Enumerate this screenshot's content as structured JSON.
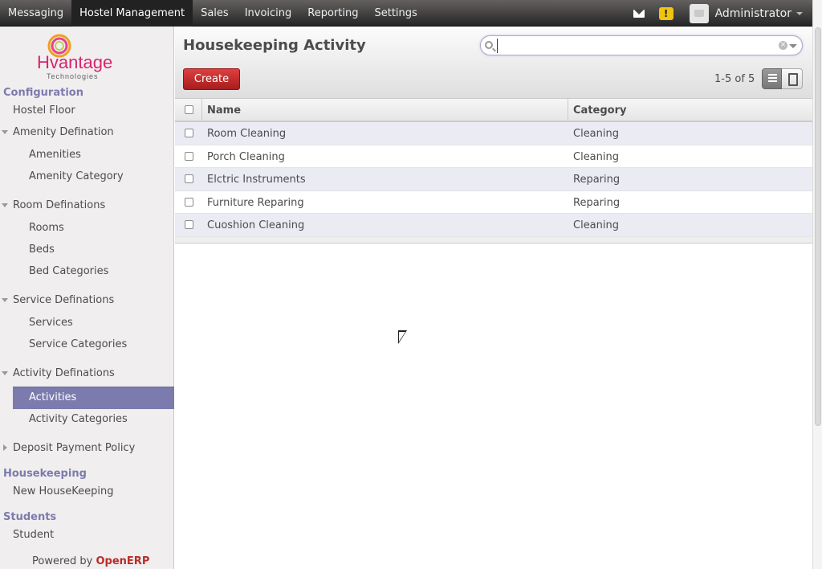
{
  "topbar": {
    "menu": [
      {
        "label": "Messaging",
        "active": false
      },
      {
        "label": "Hostel Management",
        "active": true
      },
      {
        "label": "Sales",
        "active": false
      },
      {
        "label": "Invoicing",
        "active": false
      },
      {
        "label": "Reporting",
        "active": false
      },
      {
        "label": "Settings",
        "active": false
      }
    ],
    "alert_symbol": "!",
    "user_name": "Administrator",
    "icons": [
      "mail-icon",
      "alert-icon",
      "avatar",
      "chevron-down-icon"
    ]
  },
  "sidebar": {
    "logo_text": "Hvantage",
    "logo_subtext": "Technologies",
    "sections": {
      "configuration": "Configuration",
      "housekeeping": "Housekeeping",
      "students": "Students"
    },
    "items": {
      "hostel_floor": "Hostel Floor",
      "amenity_defination": "Amenity Defination",
      "amenities": "Amenities",
      "amenity_category": "Amenity Category",
      "room_definations": "Room Definations",
      "rooms": "Rooms",
      "beds": "Beds",
      "bed_categories": "Bed Categories",
      "service_definations": "Service Definations",
      "services": "Services",
      "service_categories": "Service Categories",
      "activity_definations": "Activity Definations",
      "activities": "Activities",
      "activity_categories": "Activity Categories",
      "deposit_payment_policy": "Deposit Payment Policy",
      "new_housekeeping": "New HouseKeeping",
      "student": "Student"
    },
    "powered_by": "Powered by",
    "powered_brand": "OpenERP"
  },
  "main": {
    "title": "Housekeeping Activity",
    "search": {
      "value": "",
      "placeholder": ""
    },
    "create_label": "Create",
    "pager": "1-5 of 5",
    "columns": {
      "name": "Name",
      "category": "Category"
    },
    "rows": [
      {
        "name": "Room Cleaning",
        "category": "Cleaning"
      },
      {
        "name": "Porch Cleaning",
        "category": "Cleaning"
      },
      {
        "name": "Elctric Instruments",
        "category": "Reparing"
      },
      {
        "name": "Furniture Reparing",
        "category": "Reparing"
      },
      {
        "name": "Cuoshion Cleaning",
        "category": "Cleaning"
      }
    ]
  },
  "colors": {
    "accent": "#7c7bad",
    "create_button": "#c62828",
    "brand_red": "#b92c28"
  }
}
